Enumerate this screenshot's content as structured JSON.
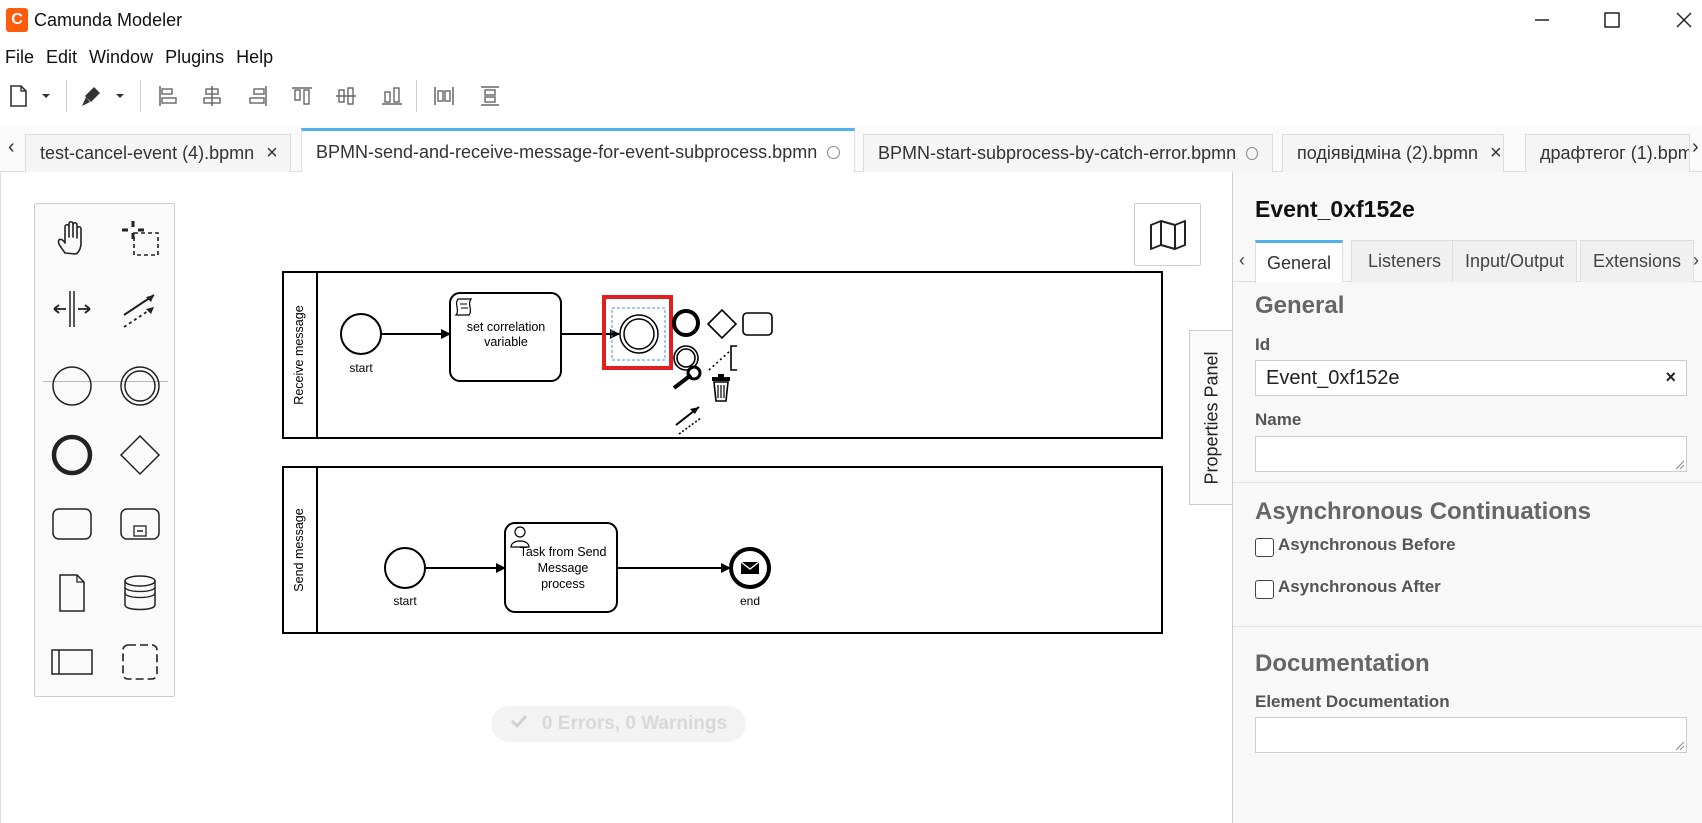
{
  "app": {
    "title": "Camunda Modeler",
    "logo_glyph": "C",
    "accent_color": "#52b0ec",
    "brand_color": "#fc5d0d",
    "selection_color": "#e02020"
  },
  "menu": {
    "items": [
      "File",
      "Edit",
      "Window",
      "Plugins",
      "Help"
    ]
  },
  "toolbar": {
    "icons": [
      "new-file-icon",
      "dropdown-icon",
      "color-picker-icon",
      "dropdown-icon",
      "align-left-icon",
      "align-center-icon",
      "align-right-icon",
      "align-top-icon",
      "align-middle-icon",
      "align-bottom-icon",
      "distribute-horizontal-icon",
      "distribute-vertical-icon"
    ]
  },
  "tabs": {
    "scroll_left": "‹",
    "scroll_right": "›",
    "items": [
      {
        "label": "test-cancel-event (4).bpmn",
        "close": "×"
      },
      {
        "label": "BPMN-send-and-receive-message-for-event-subprocess.bpmn",
        "active": true
      },
      {
        "label": "BPMN-start-subprocess-by-catch-error.bpmn"
      },
      {
        "label": "подіявідміна (2).bpmn",
        "close": "×"
      },
      {
        "label": "драфтегог (1).bpm"
      }
    ]
  },
  "canvas": {
    "palette_tools": [
      "hand-tool-icon",
      "lasso-tool-icon",
      "space-tool-icon",
      "connect-tool-icon",
      "start-event-icon",
      "intermediate-event-icon",
      "end-event-icon",
      "gateway-icon",
      "task-icon",
      "subprocess-icon",
      "data-object-icon",
      "data-store-icon",
      "pool-icon",
      "group-icon"
    ],
    "pools": [
      {
        "name": "Receive message",
        "start_label": "start",
        "task_label_lines": [
          "set correlation",
          "variable"
        ]
      },
      {
        "name": "Send message",
        "start_label": "start",
        "task_label_lines": [
          "Task from Send",
          "Message",
          "process"
        ],
        "end_label": "end"
      }
    ],
    "status": "0 Errors, 0 Warnings"
  },
  "properties_toggle": "Properties Panel",
  "properties": {
    "title": "Event_0xf152e",
    "tabs": {
      "scroll_left": "‹",
      "scroll_right": "›",
      "items": [
        "General",
        "Listeners",
        "Input/Output",
        "Extensions"
      ]
    },
    "general": {
      "title": "General",
      "id_label": "Id",
      "id_value": "Event_0xf152e",
      "clear": "×",
      "name_label": "Name",
      "name_value": ""
    },
    "async": {
      "title": "Asynchronous Continuations",
      "before_label": "Asynchronous Before",
      "after_label": "Asynchronous After"
    },
    "docs": {
      "title": "Documentation",
      "label": "Element Documentation"
    }
  }
}
